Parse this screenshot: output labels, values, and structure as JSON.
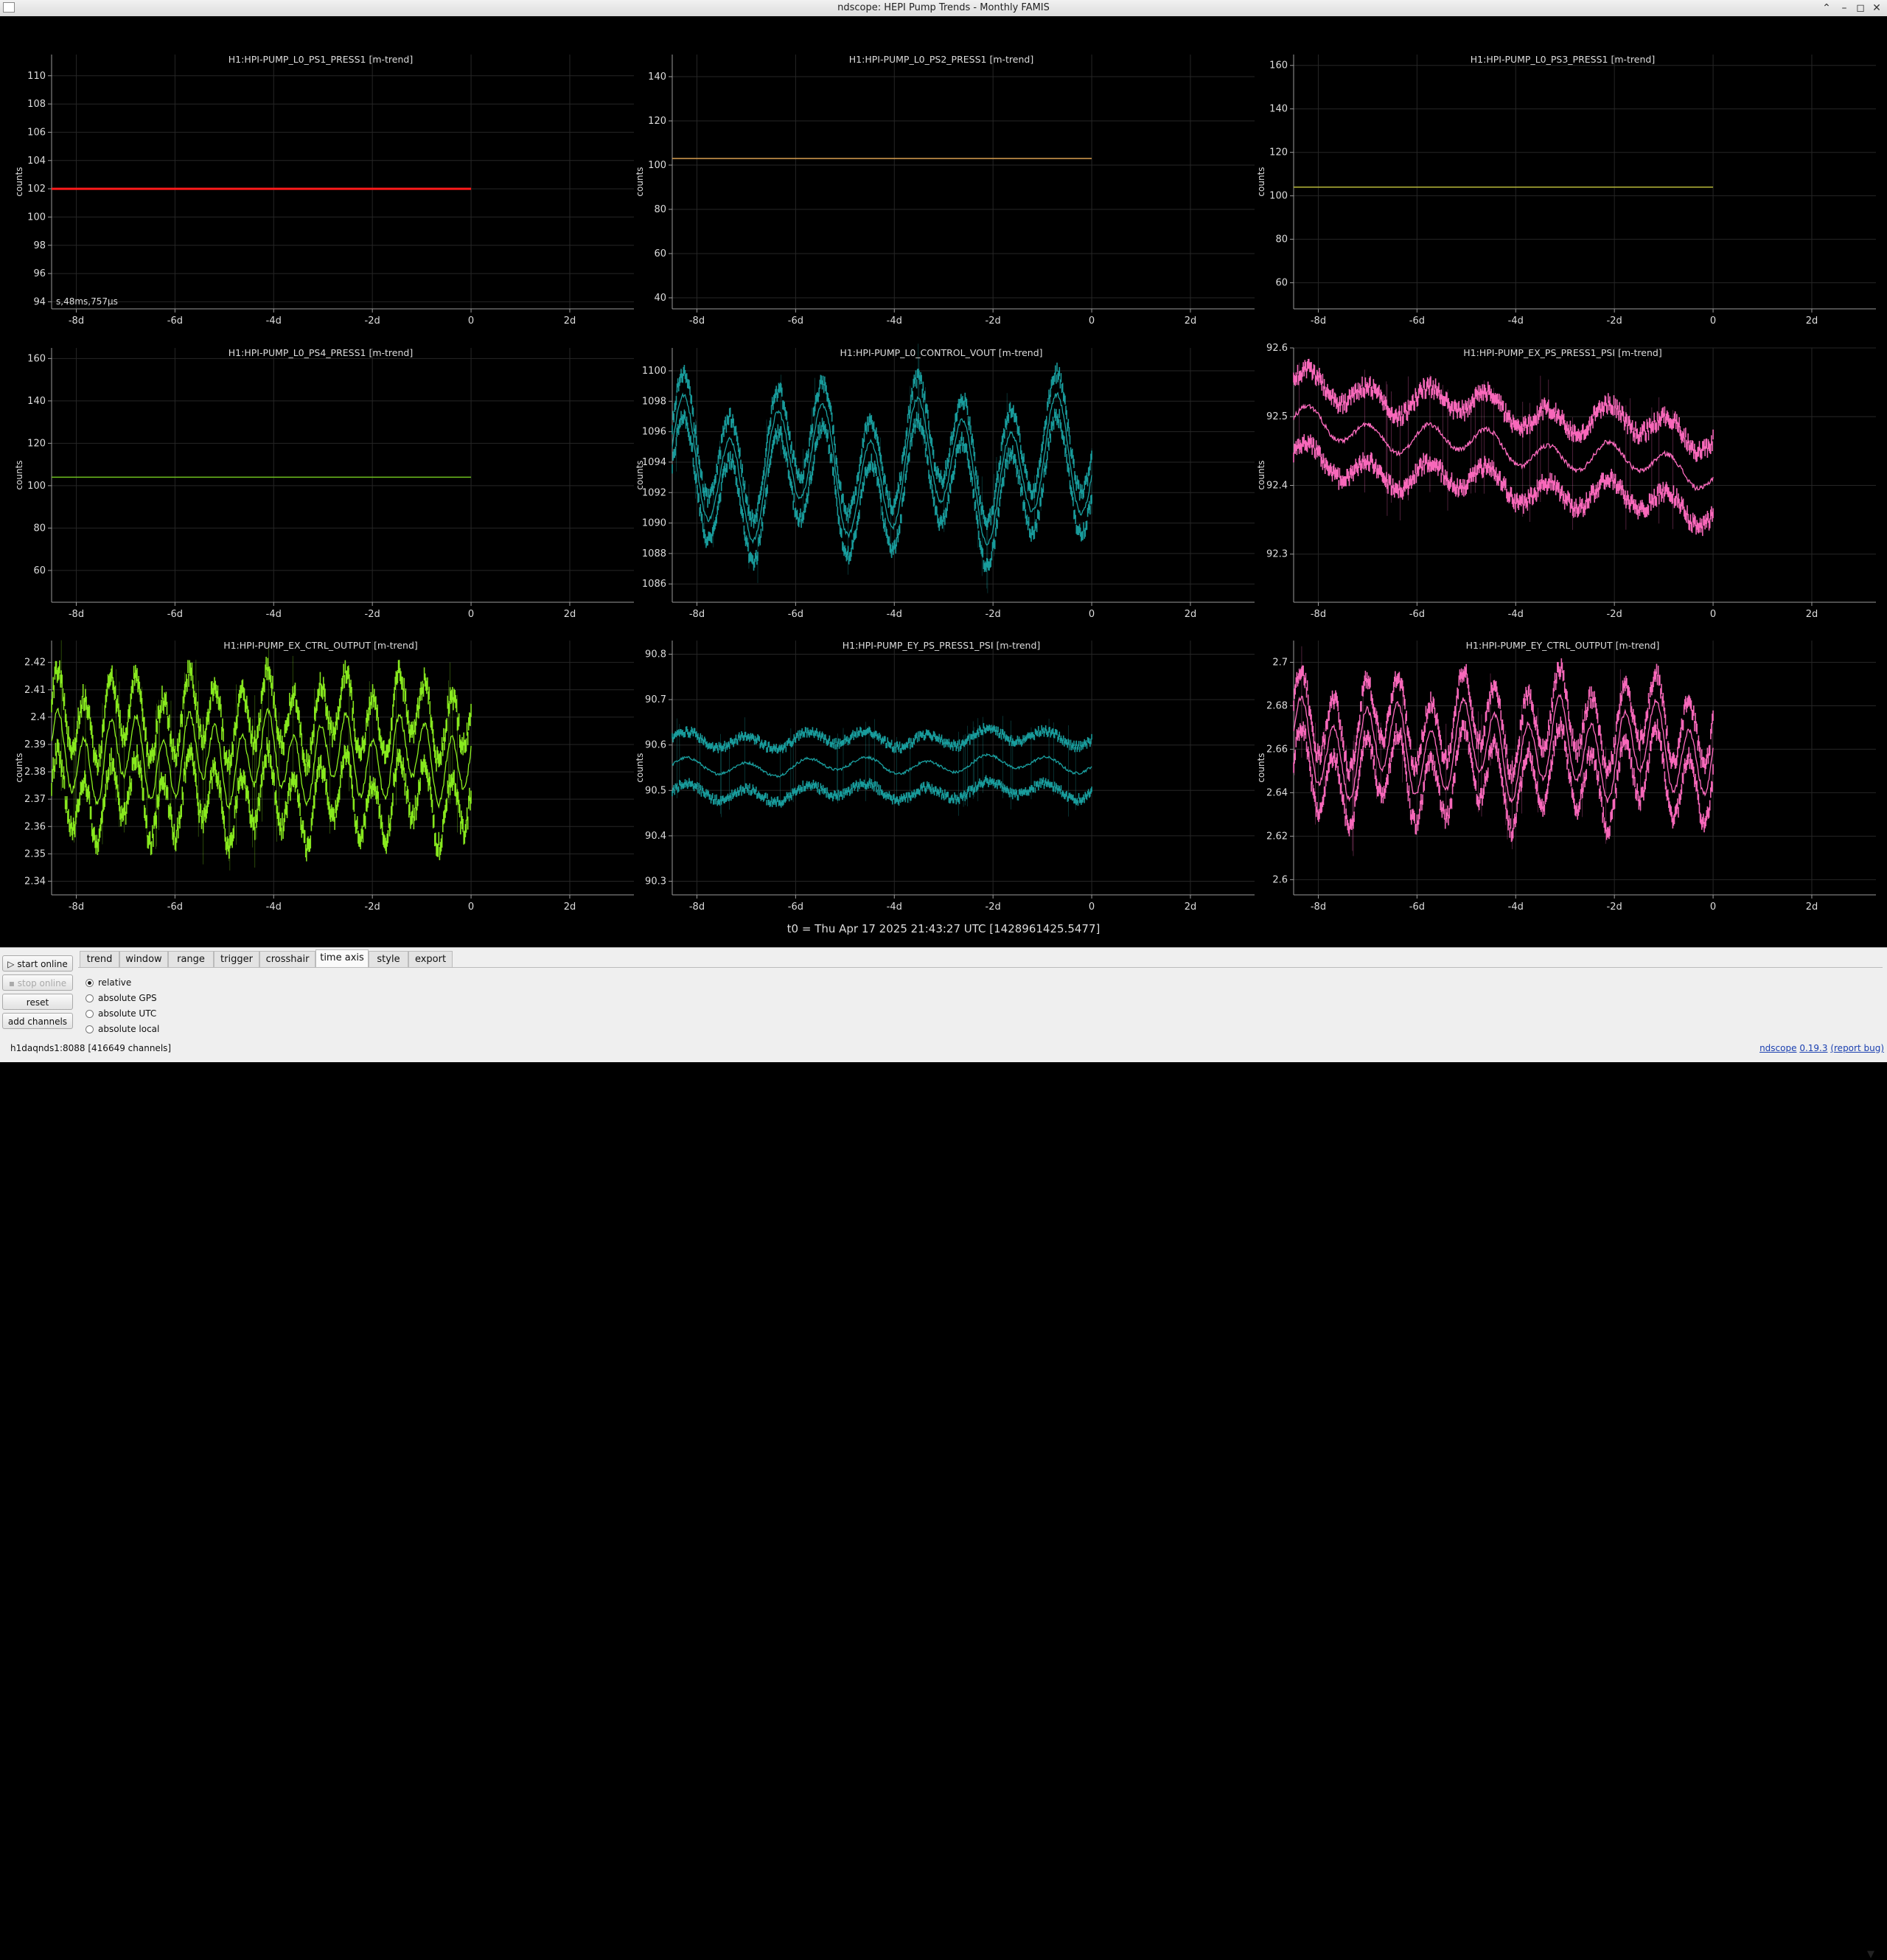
{
  "window": {
    "title": "ndscope: HEPI Pump Trends - Monthly FAMIS",
    "controls": {
      "up": "⌃",
      "minimize": "–",
      "maximize": "◻",
      "close": "✕"
    }
  },
  "colors": {
    "red": "#ff1a1a",
    "orange": "#d9a050",
    "olive": "#b8b83a",
    "green": "#6fc21e",
    "teal": "#1aa0a0",
    "pink": "#ff6cc0",
    "lime": "#8cf020",
    "grid": "#262626",
    "axis": "#9a9a9a",
    "text": "#dddddd"
  },
  "ylabel": "counts",
  "x_ticks": [
    "-8d",
    "-6d",
    "-4d",
    "-2d",
    "0",
    "2d"
  ],
  "plots": [
    {
      "title": "H1:HPI-PUMP_L0_PS1_PRESS1 [m-trend]",
      "yticks": [
        "94",
        "96",
        "98",
        "100",
        "102",
        "104",
        "106",
        "108",
        "110"
      ],
      "ylim": [
        93.5,
        111.5
      ],
      "kind": "flat",
      "value": 102,
      "color": "red",
      "overlay_text": "s,48ms,757µs"
    },
    {
      "title": "H1:HPI-PUMP_L0_PS2_PRESS1 [m-trend]",
      "yticks": [
        "40",
        "60",
        "80",
        "100",
        "120",
        "140"
      ],
      "ylim": [
        35,
        150
      ],
      "kind": "flat",
      "value": 103,
      "color": "orange"
    },
    {
      "title": "H1:HPI-PUMP_L0_PS3_PRESS1 [m-trend]",
      "yticks": [
        "60",
        "80",
        "100",
        "120",
        "140",
        "160"
      ],
      "ylim": [
        48,
        165
      ],
      "kind": "flat",
      "value": 104,
      "color": "olive"
    },
    {
      "title": "H1:HPI-PUMP_L0_PS4_PRESS1 [m-trend]",
      "yticks": [
        "60",
        "80",
        "100",
        "120",
        "140",
        "160"
      ],
      "ylim": [
        45,
        165
      ],
      "kind": "flat",
      "value": 104,
      "color": "green"
    },
    {
      "title": "H1:HPI-PUMP_L0_CONTROL_VOUT [m-trend]",
      "yticks": [
        "1086",
        "1088",
        "1090",
        "1092",
        "1094",
        "1096",
        "1098",
        "1100"
      ],
      "ylim": [
        1084.8,
        1101.5
      ],
      "kind": "noisy",
      "center": 1093.5,
      "amp": 4.5,
      "band": 1.0,
      "cycles": 9,
      "trend": 0,
      "noise": 0.5,
      "color": "teal"
    },
    {
      "title": "H1:HPI-PUMP_EX_PS_PRESS1_PSI [m-trend]",
      "yticks": [
        "92.3",
        "92.4",
        "92.5",
        "92.6"
      ],
      "ylim": [
        92.23,
        92.6
      ],
      "kind": "noisy",
      "center": 92.455,
      "amp": 0.025,
      "band": 0.045,
      "cycles": 7,
      "trend": -0.07,
      "noise": 0.012,
      "color": "pink"
    },
    {
      "title": "H1:HPI-PUMP_EX_CTRL_OUTPUT [m-trend]",
      "yticks": [
        "2.34",
        "2.35",
        "2.36",
        "2.37",
        "2.38",
        "2.39",
        "2.4",
        "2.41",
        "2.42"
      ],
      "ylim": [
        2.335,
        2.428
      ],
      "kind": "noisy",
      "center": 2.385,
      "amp": 0.016,
      "band": 0.012,
      "cycles": 16,
      "trend": 0,
      "noise": 0.004,
      "color": "lime"
    },
    {
      "title": "H1:HPI-PUMP_EY_PS_PRESS1_PSI [m-trend]",
      "yticks": [
        "90.3",
        "90.4",
        "90.5",
        "90.6",
        "90.7",
        "90.8"
      ],
      "ylim": [
        90.27,
        90.83
      ],
      "kind": "noisy",
      "center": 90.555,
      "amp": 0.02,
      "band": 0.05,
      "cycles": 7,
      "trend": 0.01,
      "noise": 0.01,
      "color": "teal"
    },
    {
      "title": "H1:HPI-PUMP_EY_CTRL_OUTPUT [m-trend]",
      "yticks": [
        "2.6",
        "2.62",
        "2.64",
        "2.66",
        "2.68",
        "2.7"
      ],
      "ylim": [
        2.593,
        2.71
      ],
      "kind": "noisy",
      "center": 2.66,
      "amp": 0.022,
      "band": 0.01,
      "cycles": 13,
      "trend": 0,
      "noise": 0.004,
      "color": "pink"
    }
  ],
  "t0_label": "t0 = Thu Apr 17 2025 21:43:27 UTC [1428961425.5477]",
  "buttons": {
    "start_online": "start online",
    "stop_online": "stop online",
    "reset": "reset",
    "add_channels": "add channels"
  },
  "tabs": [
    {
      "label": "trend",
      "active": false
    },
    {
      "label": "window",
      "active": false
    },
    {
      "label": "range",
      "active": false
    },
    {
      "label": "trigger",
      "active": false
    },
    {
      "label": "crosshair",
      "active": false
    },
    {
      "label": "time axis",
      "active": true
    },
    {
      "label": "style",
      "active": false
    },
    {
      "label": "export",
      "active": false
    }
  ],
  "time_axis_options": [
    {
      "label": "relative",
      "selected": true
    },
    {
      "label": "absolute GPS",
      "selected": false
    },
    {
      "label": "absolute UTC",
      "selected": false
    },
    {
      "label": "absolute local",
      "selected": false
    }
  ],
  "status": {
    "server": "h1daqnds1:8088",
    "channels": "[416649 channels]"
  },
  "links": {
    "ndscope": "ndscope",
    "version": "0.19.3",
    "report_bug": "(report bug)"
  }
}
